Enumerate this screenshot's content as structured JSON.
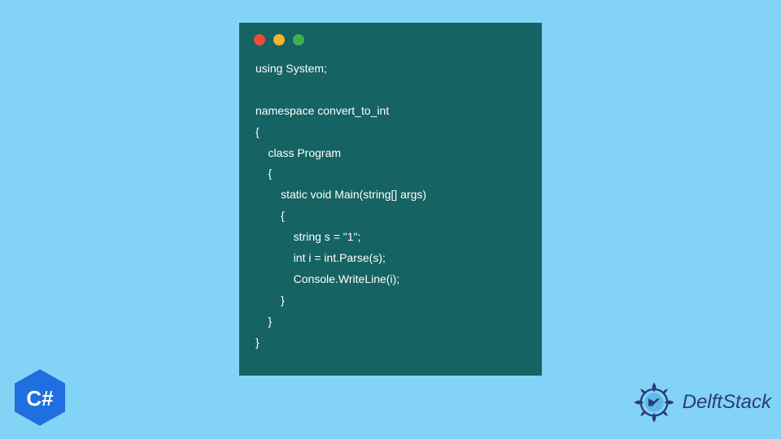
{
  "window": {
    "traffic_lights": [
      "close",
      "minimize",
      "maximize"
    ]
  },
  "code": {
    "lines": [
      "using System;",
      "",
      "namespace convert_to_int",
      "{",
      "    class Program",
      "    {",
      "        static void Main(string[] args)",
      "        {",
      "            string s = \"1\";",
      "            int i = int.Parse(s);",
      "            Console.WriteLine(i);",
      "        }",
      "    }",
      "}"
    ]
  },
  "badges": {
    "language_label": "C#",
    "site_name": "DelftStack"
  },
  "colors": {
    "background": "#82d3f5",
    "window_bg": "#156363",
    "code_fg": "#ffffff",
    "badge_blue": "#1f6fe0",
    "delft_blue": "#2a3a7a"
  }
}
